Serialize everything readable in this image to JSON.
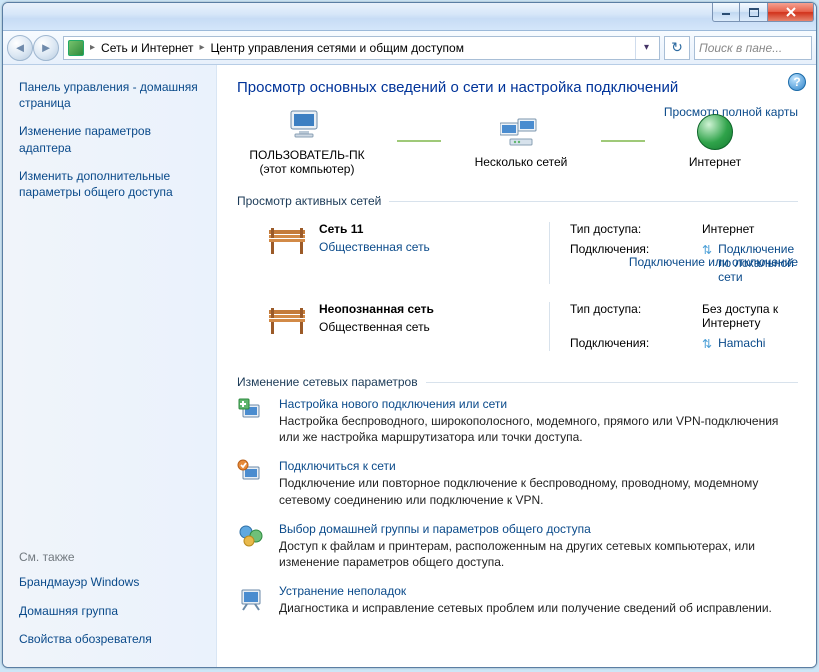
{
  "breadcrumb": {
    "part1": "Сеть и Интернет",
    "part2": "Центр управления сетями и общим доступом"
  },
  "search": {
    "placeholder": "Поиск в пане..."
  },
  "sidebar": {
    "home": "Панель управления - домашняя страница",
    "adapter": "Изменение параметров адаптера",
    "sharing": "Изменить дополнительные параметры общего доступа",
    "see_also": "См. также",
    "firewall": "Брандмауэр Windows",
    "homegroup": "Домашняя группа",
    "inetopts": "Свойства обозревателя"
  },
  "main": {
    "title": "Просмотр основных сведений о сети и настройка подключений",
    "map_link": "Просмотр полной карты",
    "node1": {
      "label": "ПОЛЬЗОВАТЕЛЬ-ПК",
      "sub": "(этот компьютер)"
    },
    "node2": {
      "label": "Несколько сетей"
    },
    "node3": {
      "label": "Интернет"
    },
    "active_title": "Просмотр активных сетей",
    "connect_link": "Подключение или отключение",
    "net1": {
      "name": "Сеть  11",
      "type": "Общественная сеть",
      "k1": "Тип доступа:",
      "v1": "Интернет",
      "k2": "Подключения:",
      "v2": "Подключение по локальной сети"
    },
    "net2": {
      "name": "Неопознанная сеть",
      "type": "Общественная сеть",
      "k1": "Тип доступа:",
      "v1": "Без доступа к Интернету",
      "k2": "Подключения:",
      "v2": "Hamachi"
    },
    "settings_title": "Изменение сетевых параметров",
    "task1": {
      "title": "Настройка нового подключения или сети",
      "desc": "Настройка беспроводного, широкополосного, модемного, прямого или VPN-подключения или же настройка маршрутизатора или точки доступа."
    },
    "task2": {
      "title": "Подключиться к сети",
      "desc": "Подключение или повторное подключение к беспроводному, проводному, модемному сетевому соединению или подключение к VPN."
    },
    "task3": {
      "title": "Выбор домашней группы и параметров общего доступа",
      "desc": "Доступ к файлам и принтерам, расположенным на других сетевых компьютерах, или изменение параметров общего доступа."
    },
    "task4": {
      "title": "Устранение неполадок",
      "desc": "Диагностика и исправление сетевых проблем или получение сведений об исправлении."
    }
  }
}
